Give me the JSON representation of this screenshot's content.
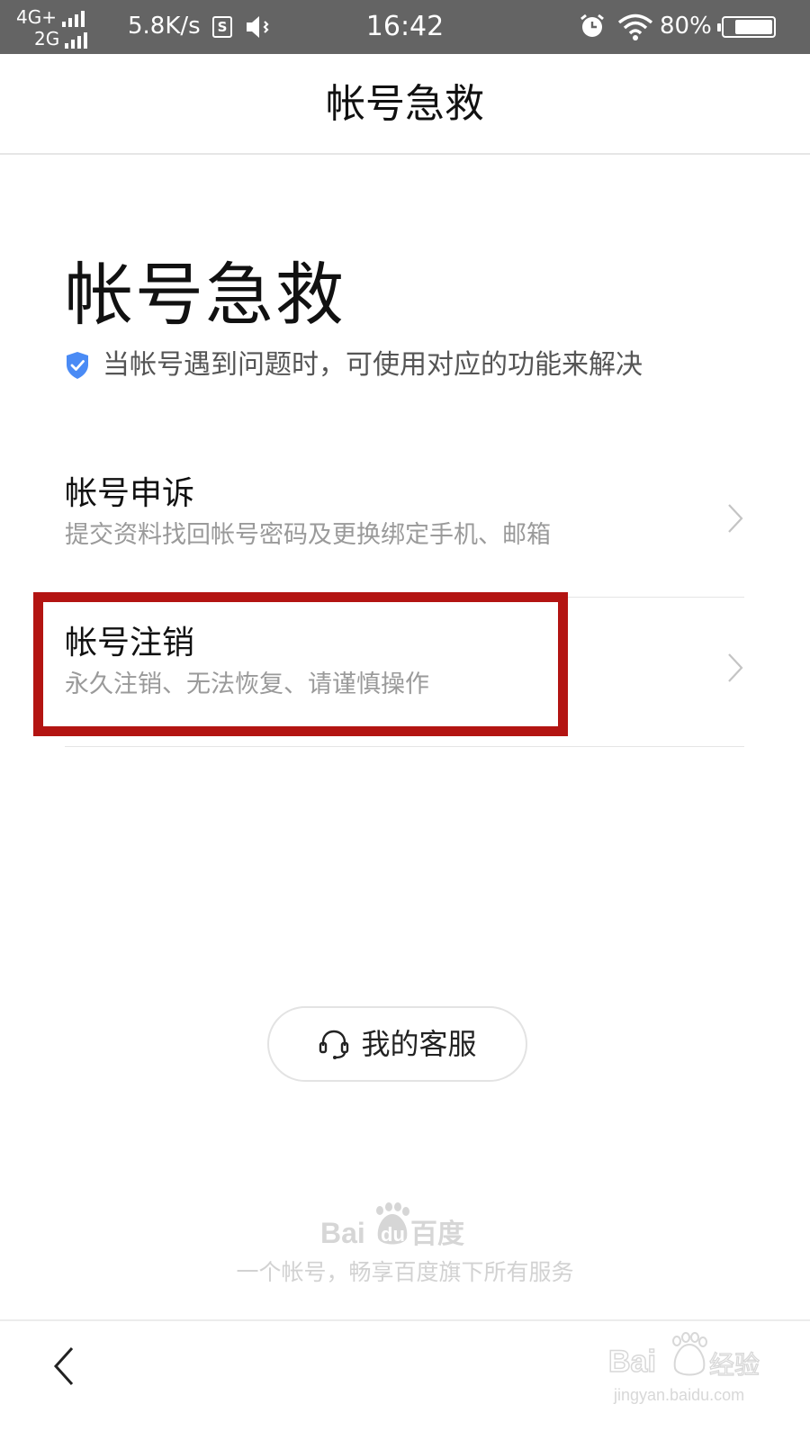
{
  "status_bar": {
    "net_primary": "4G+",
    "net_secondary": "2G",
    "speed": "5.8K/s",
    "s_badge": "S",
    "time": "16:42",
    "battery_percent": "80%",
    "battery_level": 0.8
  },
  "nav": {
    "title": "帐号急救"
  },
  "header": {
    "title": "帐号急救",
    "subtitle": "当帐号遇到问题时，可使用对应的功能来解决",
    "subtitle_icon": "shield-check-icon"
  },
  "items": [
    {
      "title": "帐号申诉",
      "desc": "提交资料找回帐号密码及更换绑定手机、邮箱",
      "icon": "chevron-right-icon"
    },
    {
      "title": "帐号注销",
      "desc": "永久注销、无法恢复、请谨慎操作",
      "icon": "chevron-right-icon"
    }
  ],
  "highlight_color": "#b31412",
  "customer_service": {
    "label": "我的客服",
    "icon": "headset-icon"
  },
  "footer": {
    "logo_text": "Bai du 百度",
    "slogan": "一个帐号，畅享百度旗下所有服务"
  },
  "toolbar": {
    "back_icon": "back-arrow-icon",
    "watermark_text": "Baidu 经验",
    "watermark_url": "jingyan.baidu.com"
  },
  "colors": {
    "status_bar_bg": "#646464",
    "accent_blue": "#4a8bf5",
    "secondary_text": "#9a9a9a"
  }
}
